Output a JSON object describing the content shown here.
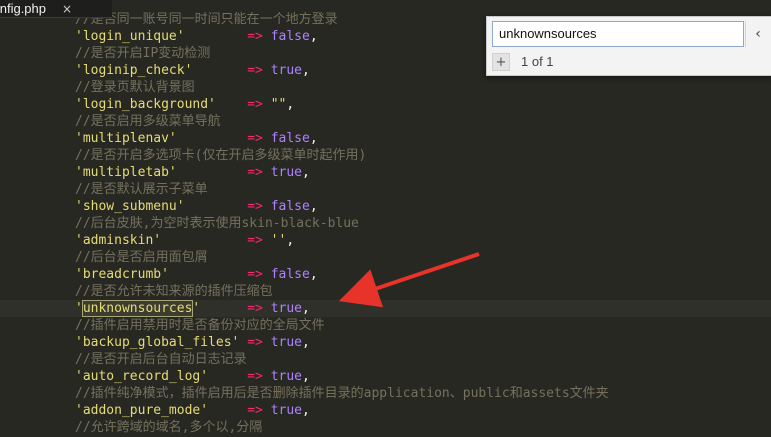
{
  "tab": {
    "title": "config.php",
    "close_icon": "×"
  },
  "editor": {
    "lines": [
      {
        "type": "comment",
        "text": "//是否同一账号同一时间只能在一个地方登录"
      },
      {
        "type": "kv",
        "key": "'login_unique'",
        "pad": "        ",
        "arrow": "=>",
        "value": "false",
        "value_type": "kw",
        "tail": ","
      },
      {
        "type": "comment",
        "text": "//是否开启IP变动检测"
      },
      {
        "type": "kv",
        "key": "'loginip_check'",
        "pad": "       ",
        "arrow": "=>",
        "value": "true",
        "value_type": "kw",
        "tail": ","
      },
      {
        "type": "comment",
        "text": "//登录页默认背景图"
      },
      {
        "type": "kv",
        "key": "'login_background'",
        "pad": "    ",
        "arrow": "=>",
        "value": "\"\"",
        "value_type": "str",
        "tail": ","
      },
      {
        "type": "comment",
        "text": "//是否启用多级菜单导航"
      },
      {
        "type": "kv",
        "key": "'multiplenav'",
        "pad": "         ",
        "arrow": "=>",
        "value": "false",
        "value_type": "kw",
        "tail": ","
      },
      {
        "type": "comment",
        "text": "//是否开启多选项卡(仅在开启多级菜单时起作用)"
      },
      {
        "type": "kv",
        "key": "'multipletab'",
        "pad": "         ",
        "arrow": "=>",
        "value": "true",
        "value_type": "kw",
        "tail": ","
      },
      {
        "type": "comment",
        "text": "//是否默认展示子菜单"
      },
      {
        "type": "kv",
        "key": "'show_submenu'",
        "pad": "        ",
        "arrow": "=>",
        "value": "false",
        "value_type": "kw",
        "tail": ","
      },
      {
        "type": "comment",
        "text": "//后台皮肤,为空时表示使用skin-black-blue"
      },
      {
        "type": "kv",
        "key": "'adminskin'",
        "pad": "           ",
        "arrow": "=>",
        "value": "''",
        "value_type": "str",
        "tail": ","
      },
      {
        "type": "comment",
        "text": "//后台是否启用面包屑"
      },
      {
        "type": "kv",
        "key": "'breadcrumb'",
        "pad": "          ",
        "arrow": "=>",
        "value": "false",
        "value_type": "kw",
        "tail": ","
      },
      {
        "type": "comment",
        "text": "//是否允许未知来源的插件压缩包"
      },
      {
        "type": "kv_hl",
        "quote": "'",
        "key_inner": "unknownsources",
        "pad": "      ",
        "arrow": "=>",
        "value": "true",
        "value_type": "kw",
        "tail": ","
      },
      {
        "type": "comment",
        "text": "//插件启用禁用时是否备份对应的全局文件"
      },
      {
        "type": "kv",
        "key": "'backup_global_files'",
        "pad": " ",
        "arrow": "=>",
        "value": "true",
        "value_type": "kw",
        "tail": ","
      },
      {
        "type": "comment",
        "text": "//是否开启后台自动日志记录"
      },
      {
        "type": "kv",
        "key": "'auto_record_log'",
        "pad": "     ",
        "arrow": "=>",
        "value": "true",
        "value_type": "kw",
        "tail": ","
      },
      {
        "type": "comment",
        "text": "//插件纯净模式，插件启用后是否删除插件目录的application、public和assets文件夹"
      },
      {
        "type": "kv",
        "key": "'addon_pure_mode'",
        "pad": "     ",
        "arrow": "=>",
        "value": "true",
        "value_type": "kw",
        "tail": ","
      },
      {
        "type": "comment",
        "text": "//允许跨域的域名,多个以,分隔"
      }
    ]
  },
  "find": {
    "query": "unknownsources",
    "count": "1 of 1",
    "add_label": "+",
    "prev_icon": "‹"
  },
  "annotation": {
    "arrow_color": "#e8332b"
  },
  "colors": {
    "background": "#272822",
    "comment": "#75715e",
    "string": "#e6db74",
    "operator": "#f92672",
    "constant": "#ae81ff"
  }
}
